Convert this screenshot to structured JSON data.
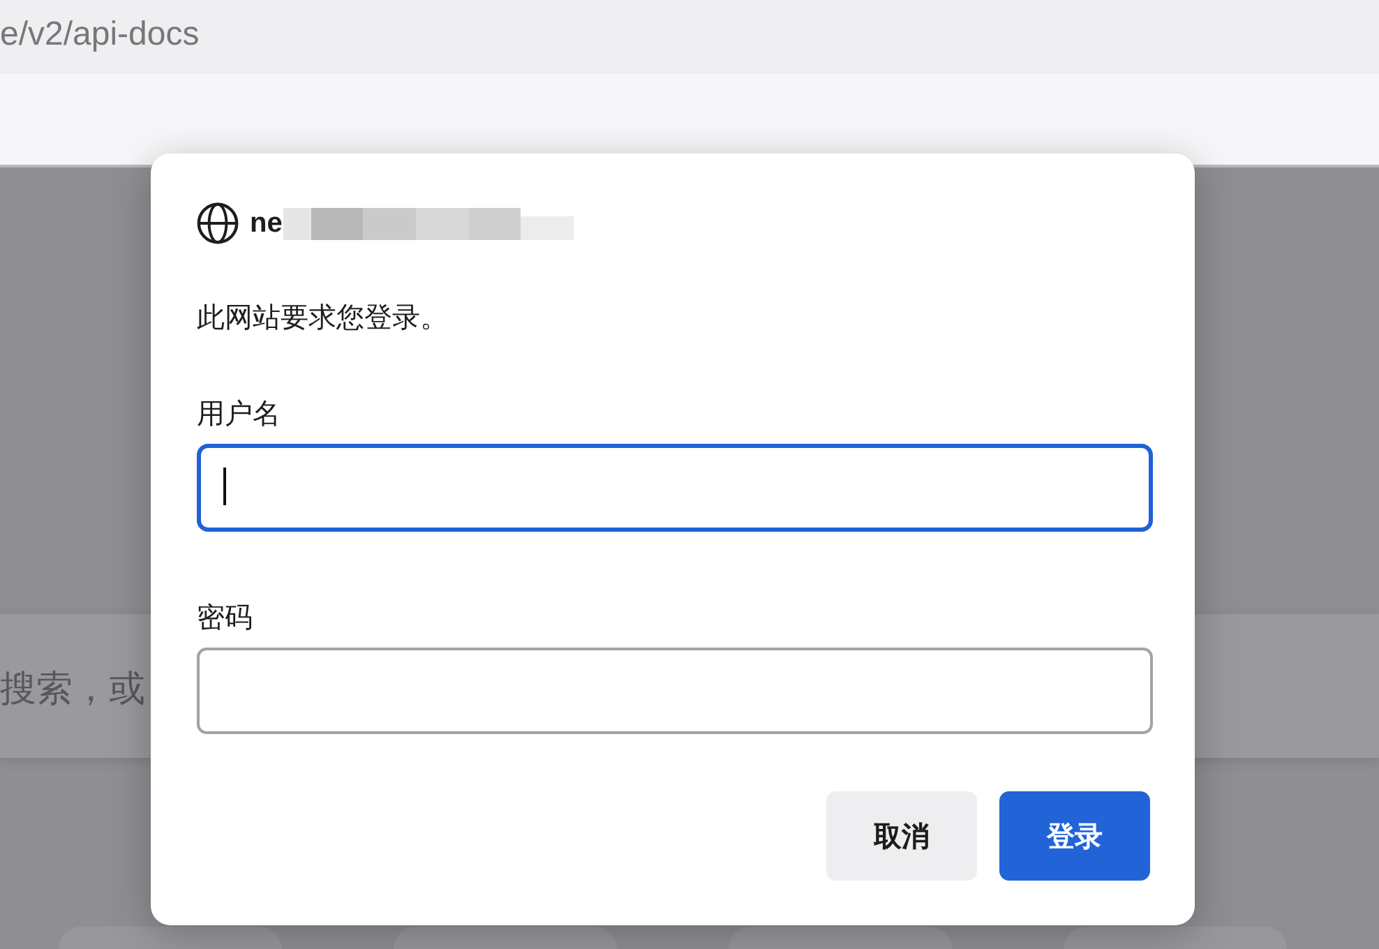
{
  "address_bar": {
    "url_text": "e/v2/api-docs"
  },
  "background_page": {
    "search_field": {
      "placeholder": "搜索，或"
    }
  },
  "dialog": {
    "site_name": "ne",
    "message": "此网站要求您登录。",
    "fields": [
      {
        "label": "用户名",
        "focused": true
      },
      {
        "label": "密码",
        "focused": false
      }
    ],
    "buttons": [
      {
        "label": "取消",
        "kind": "secondary"
      },
      {
        "label": "登录",
        "kind": "primary"
      }
    ]
  }
}
